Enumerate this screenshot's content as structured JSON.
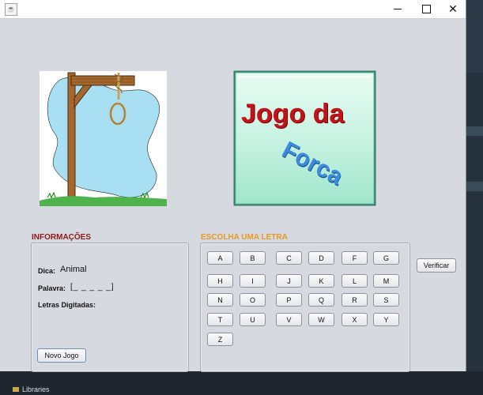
{
  "window": {
    "title": "",
    "minimize_glyph": "",
    "maximize_glyph": "",
    "close_glyph": "✕"
  },
  "logo": {
    "line1": "Jogo da",
    "line2": "Forca"
  },
  "info": {
    "title": "INFORMAÇÕES",
    "hint_label": "Dica:",
    "hint_value": "Animal",
    "word_label": "Palavra:",
    "word_value": "[_ _ _ _ _]",
    "typed_label": "Letras Digitadas:",
    "typed_value": "",
    "new_game_button": "Novo Jogo"
  },
  "letters": {
    "title": "ESCOLHA UMA LETRA",
    "rows": [
      [
        "A",
        "B",
        "C",
        "D",
        "F",
        "G"
      ],
      [
        "H",
        "I",
        "J",
        "K",
        "L",
        "M"
      ],
      [
        "N",
        "O",
        "P",
        "Q",
        "R",
        "S"
      ],
      [
        "T",
        "U",
        "V",
        "W",
        "X",
        "Y"
      ],
      [
        "Z"
      ]
    ]
  },
  "verify_button": "Verificar",
  "background": {
    "project_item": "Libraries"
  },
  "colors": {
    "window_bg": "#d6d9e0",
    "info_title": "#8b1a1a",
    "letters_title": "#e89a22",
    "logo_red": "#c4121a",
    "logo_blue": "#3b8be0"
  }
}
